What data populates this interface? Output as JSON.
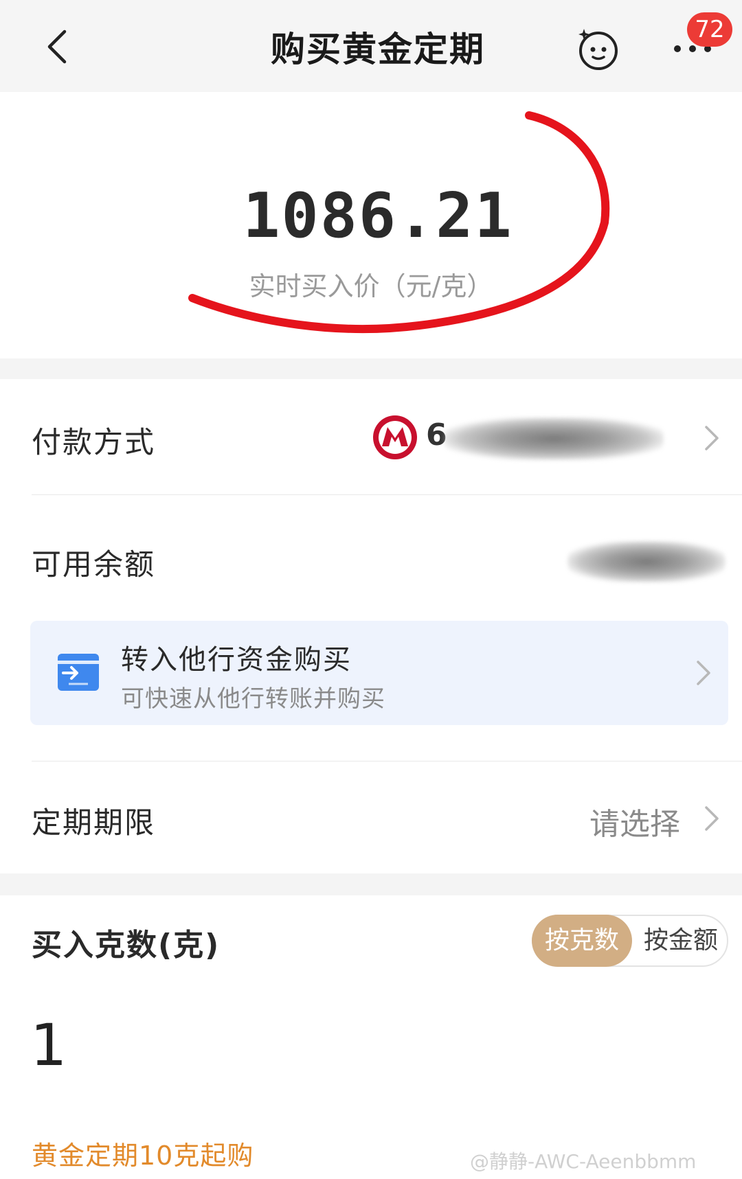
{
  "header": {
    "title": "购买黄金定期",
    "badge_count": "72"
  },
  "price": {
    "value": "1086.21",
    "label": "实时买入价（元/克）"
  },
  "payment": {
    "label": "付款方式",
    "card_visible": "6"
  },
  "balance": {
    "label": "可用余额"
  },
  "transfer": {
    "title": "转入他行资金购买",
    "subtitle": "可快速从他行转账并购买"
  },
  "term": {
    "label": "定期期限",
    "placeholder": "请选择"
  },
  "purchase": {
    "label": "买入克数(克)",
    "mode_options": [
      "按克数",
      "按金额"
    ],
    "selected_mode": "按克数",
    "input_value": "1",
    "note": "黄金定期10克起购"
  },
  "watermark": "@静静-AWC-Aeenbbmm",
  "colors": {
    "accent_gold": "#d2ae84",
    "note_orange": "#e28a2b",
    "badge_red": "#ec3b36",
    "annotation_red": "#e5141c",
    "transfer_bg": "#eef3fd",
    "bank_red": "#c8102e"
  }
}
